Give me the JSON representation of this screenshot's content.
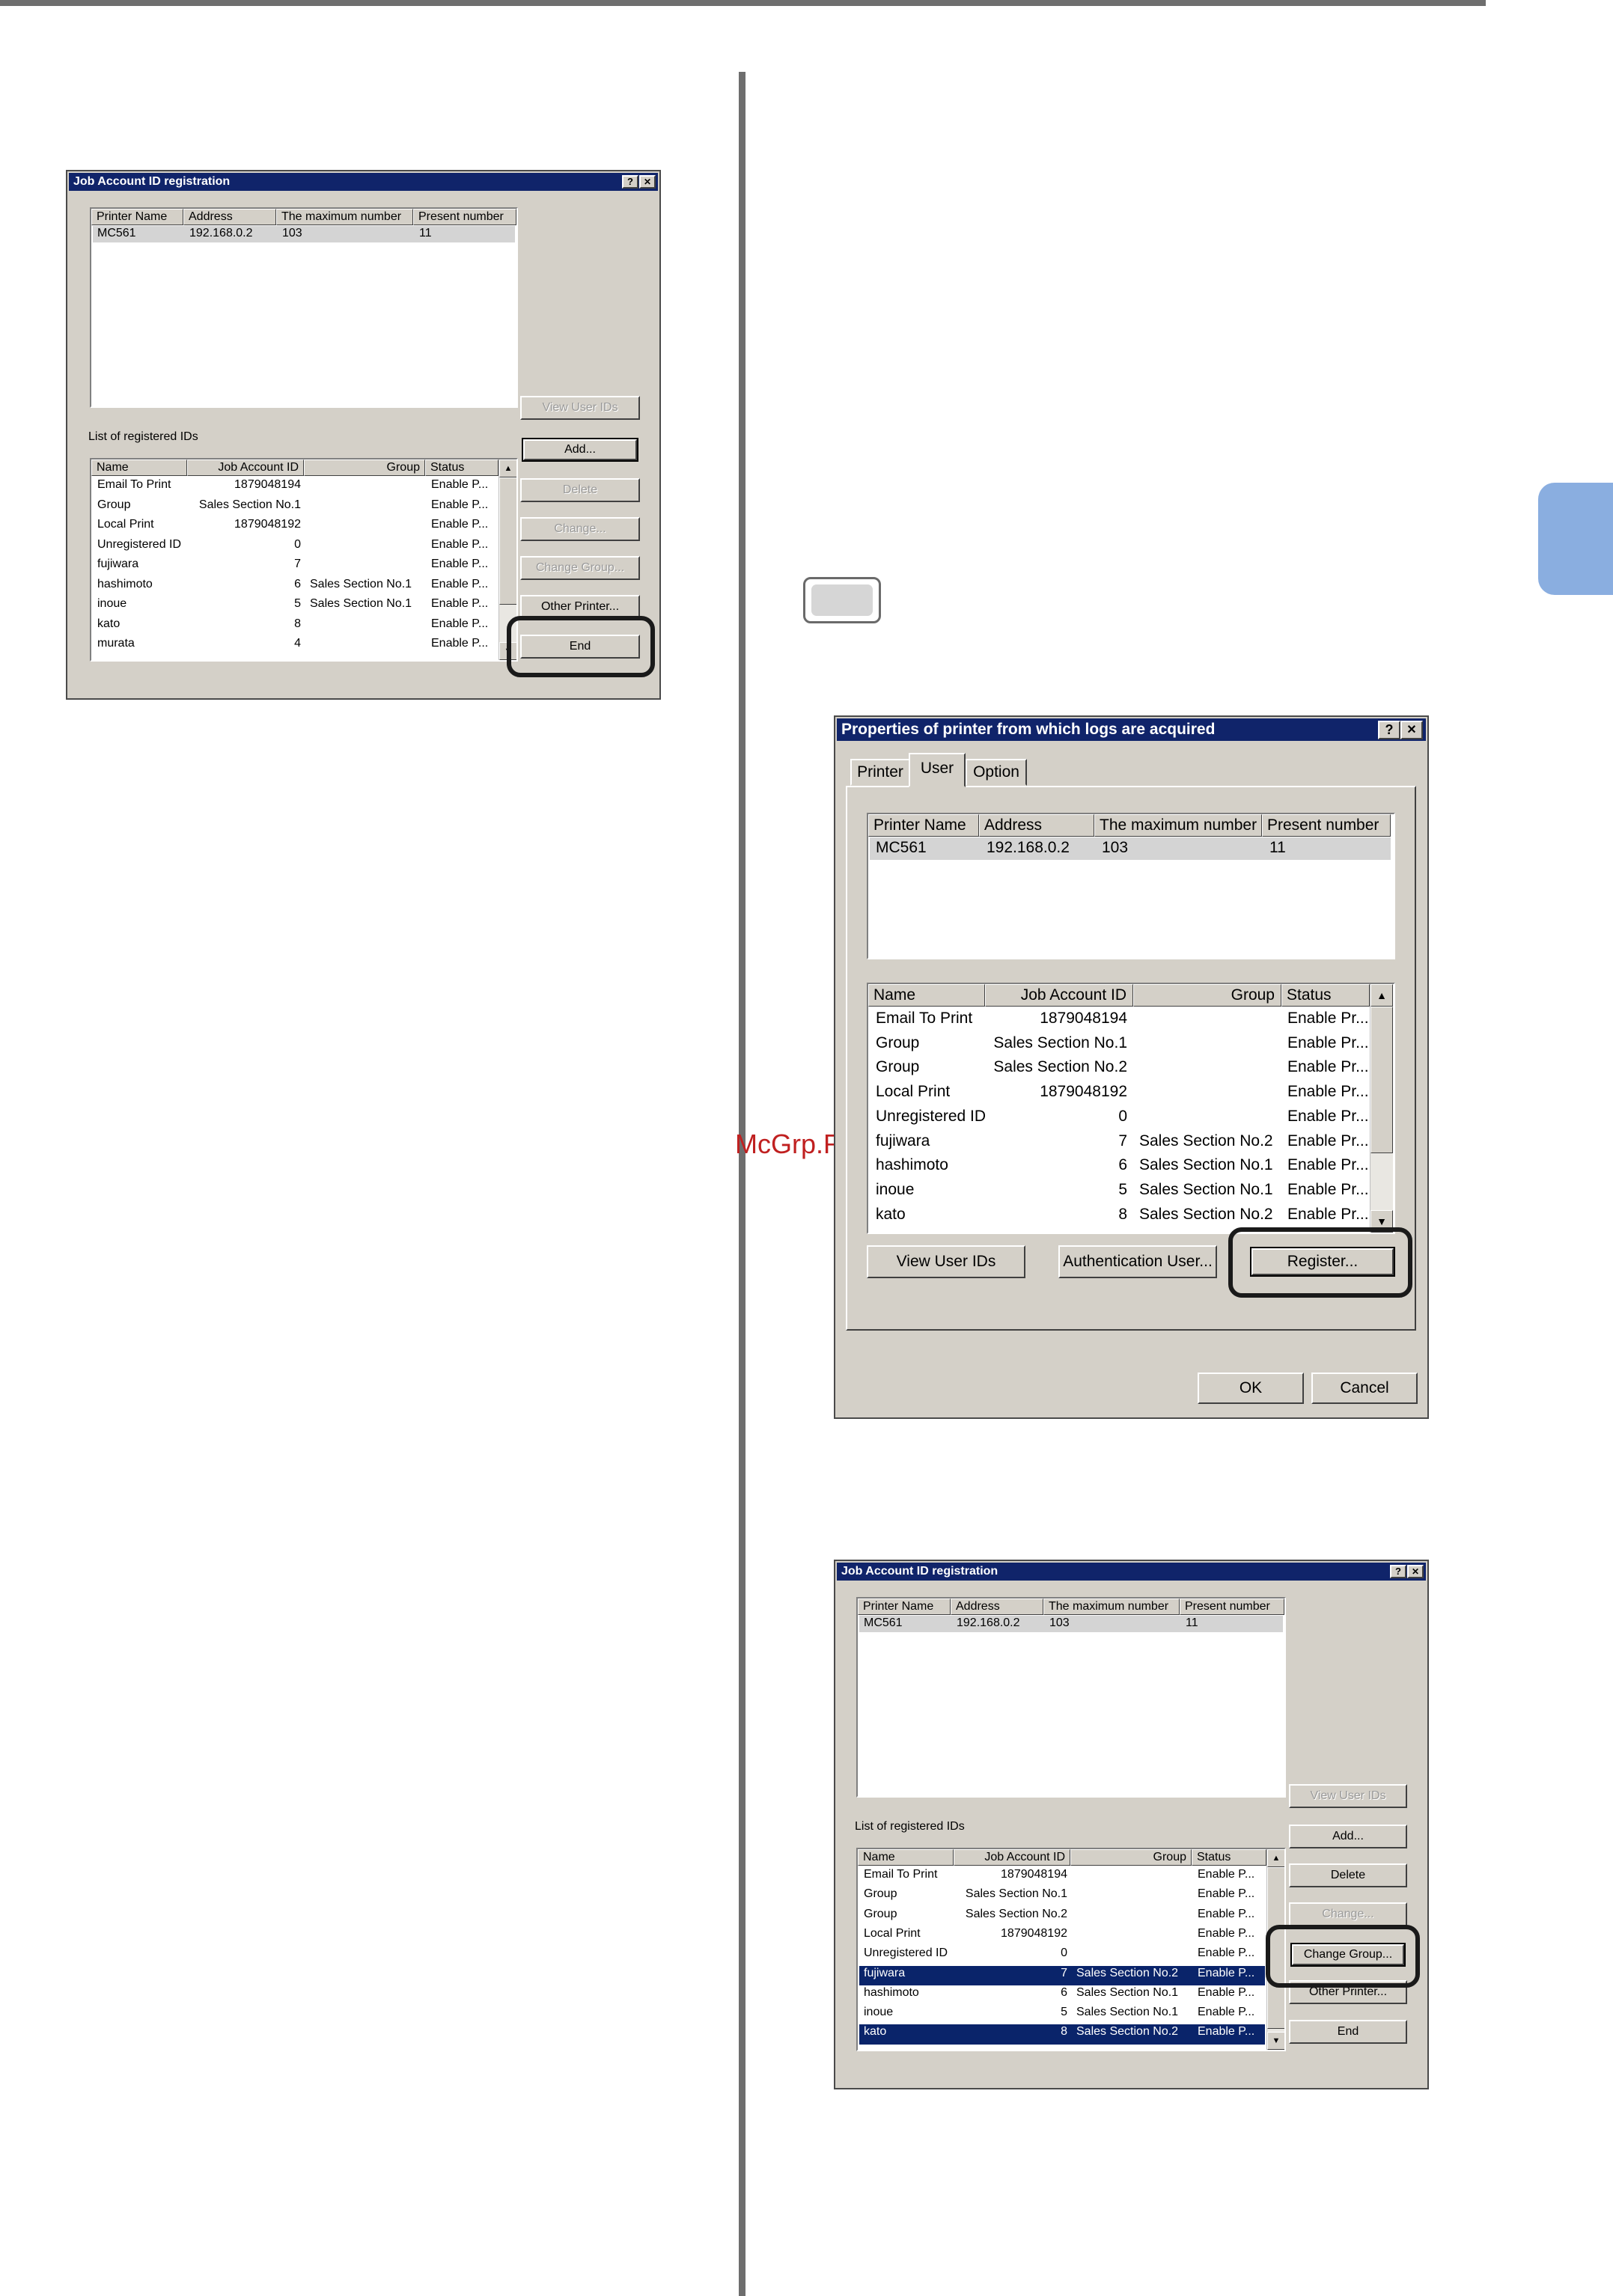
{
  "dialog1": {
    "title": "Job Account ID registration",
    "title_buttons": [
      "?",
      "✕"
    ],
    "printer_headers": [
      "Printer Name",
      "Address",
      "The maximum number",
      "Present number"
    ],
    "printer_row": [
      "MC561",
      "192.168.0.2",
      "103",
      "11"
    ],
    "list_label": "List of registered IDs",
    "id_headers": [
      "Name",
      "Job Account ID",
      "Group",
      "Status"
    ],
    "rows": [
      {
        "name": "Email To Print",
        "id": "1879048194",
        "group": "",
        "status": "Enable P..."
      },
      {
        "name": "Group",
        "id": "Sales Section No.1",
        "group": "",
        "status": "Enable P..."
      },
      {
        "name": "Local Print",
        "id": "1879048192",
        "group": "",
        "status": "Enable P..."
      },
      {
        "name": "Unregistered ID",
        "id": "0",
        "group": "",
        "status": "Enable P..."
      },
      {
        "name": "fujiwara",
        "id": "7",
        "group": "",
        "status": "Enable P..."
      },
      {
        "name": "hashimoto",
        "id": "6",
        "group": "Sales Section No.1",
        "status": "Enable P..."
      },
      {
        "name": "inoue",
        "id": "5",
        "group": "Sales Section No.1",
        "status": "Enable P..."
      },
      {
        "name": "kato",
        "id": "8",
        "group": "",
        "status": "Enable P..."
      },
      {
        "name": "murata",
        "id": "4",
        "group": "",
        "status": "Enable P..."
      }
    ],
    "buttons": {
      "view_user_ids": "View User IDs",
      "add": "Add...",
      "delete": "Delete",
      "change": "Change...",
      "change_group": "Change Group...",
      "other_printer": "Other Printer...",
      "end": "End"
    }
  },
  "dialog2": {
    "title": "Properties of printer from which logs are acquired",
    "title_buttons": [
      "?",
      "✕"
    ],
    "tabs": [
      "Printer",
      "User",
      "Option"
    ],
    "printer_headers": [
      "Printer Name",
      "Address",
      "The maximum number",
      "Present number"
    ],
    "printer_row": [
      "MC561",
      "192.168.0.2",
      "103",
      "11"
    ],
    "id_headers": [
      "Name",
      "Job Account ID",
      "Group",
      "Status"
    ],
    "rows": [
      {
        "name": "Email To Print",
        "id": "1879048194",
        "group": "",
        "status": "Enable Pr..."
      },
      {
        "name": "Group",
        "id": "Sales Section No.1",
        "group": "",
        "status": "Enable Pr..."
      },
      {
        "name": "Group",
        "id": "Sales Section No.2",
        "group": "",
        "status": "Enable Pr..."
      },
      {
        "name": "Local Print",
        "id": "1879048192",
        "group": "",
        "status": "Enable Pr..."
      },
      {
        "name": "Unregistered ID",
        "id": "0",
        "group": "",
        "status": "Enable Pr..."
      },
      {
        "name": "fujiwara",
        "id": "7",
        "group": "Sales Section No.2",
        "status": "Enable Pr..."
      },
      {
        "name": "hashimoto",
        "id": "6",
        "group": "Sales Section No.1",
        "status": "Enable Pr..."
      },
      {
        "name": "inoue",
        "id": "5",
        "group": "Sales Section No.1",
        "status": "Enable Pr..."
      },
      {
        "name": "kato",
        "id": "8",
        "group": "Sales Section No.2",
        "status": "Enable Pr..."
      }
    ],
    "buttons": {
      "view_user_ids": "View User IDs",
      "authentication_user": "Authentication User...",
      "register": "Register...",
      "ok": "OK",
      "cancel": "Cancel"
    }
  },
  "dialog3": {
    "title": "Job Account ID registration",
    "title_buttons": [
      "?",
      "✕"
    ],
    "printer_headers": [
      "Printer Name",
      "Address",
      "The maximum number",
      "Present number"
    ],
    "printer_row": [
      "MC561",
      "192.168.0.2",
      "103",
      "11"
    ],
    "list_label": "List of registered IDs",
    "id_headers": [
      "Name",
      "Job Account ID",
      "Group",
      "Status"
    ],
    "rows": [
      {
        "name": "Email To Print",
        "id": "1879048194",
        "group": "",
        "status": "Enable P..."
      },
      {
        "name": "Group",
        "id": "Sales Section No.1",
        "group": "",
        "status": "Enable P..."
      },
      {
        "name": "Group",
        "id": "Sales Section No.2",
        "group": "",
        "status": "Enable P..."
      },
      {
        "name": "Local Print",
        "id": "1879048192",
        "group": "",
        "status": "Enable P..."
      },
      {
        "name": "Unregistered ID",
        "id": "0",
        "group": "",
        "status": "Enable P..."
      },
      {
        "name": "fujiwara",
        "id": "7",
        "group": "Sales Section No.2",
        "status": "Enable P..."
      },
      {
        "name": "hashimoto",
        "id": "6",
        "group": "Sales Section No.1",
        "status": "Enable P..."
      },
      {
        "name": "inoue",
        "id": "5",
        "group": "Sales Section No.1",
        "status": "Enable P..."
      },
      {
        "name": "kato",
        "id": "8",
        "group": "Sales Section No.2",
        "status": "Enable P..."
      }
    ],
    "buttons": {
      "view_user_ids": "View User IDs",
      "add": "Add...",
      "delete": "Delete",
      "change": "Change...",
      "change_group": "Change Group...",
      "other_printer": "Other Printer...",
      "end": "End"
    }
  },
  "watermark": "McGrp.Ru",
  "colors": {
    "accent_tab": "#8aaee0",
    "titlebar": "#10246a",
    "selection": "#0a246a",
    "dialog_face": "#d4d0c8"
  }
}
